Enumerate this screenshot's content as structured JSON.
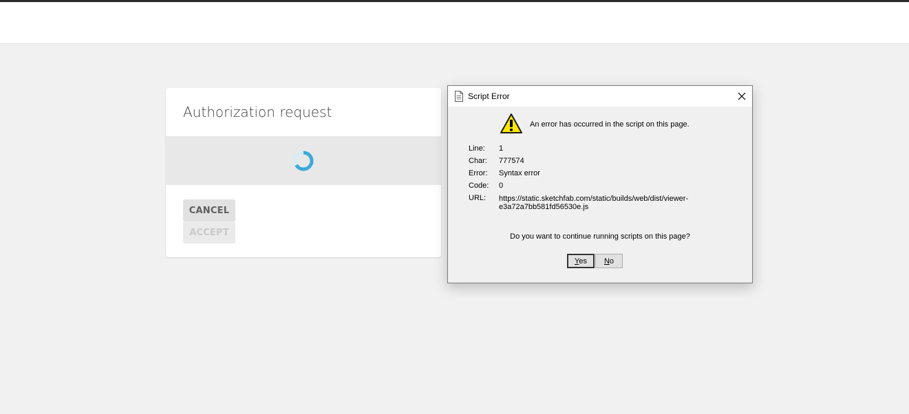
{
  "auth": {
    "title": "Authorization request",
    "cancel_label": "CANCEL",
    "accept_label": "ACCEPT",
    "spinner_color": "#3ba9d9"
  },
  "dialog": {
    "title": "Script Error",
    "message": "An error has occurred in the script on this page.",
    "fields": {
      "line_label": "Line:",
      "line_value": "1",
      "char_label": "Char:",
      "char_value": "777574",
      "error_label": "Error:",
      "error_value": "Syntax error",
      "code_label": "Code:",
      "code_value": "0",
      "url_label": "URL:",
      "url_value": "https://static.sketchfab.com/static/builds/web/dist/viewer-e3a72a7bb581fd56530e.js"
    },
    "question": "Do you want to continue running scripts on this page?",
    "yes_first": "Y",
    "yes_rest": "es",
    "no_first": "N",
    "no_rest": "o",
    "warning_color": "#ffe600"
  }
}
